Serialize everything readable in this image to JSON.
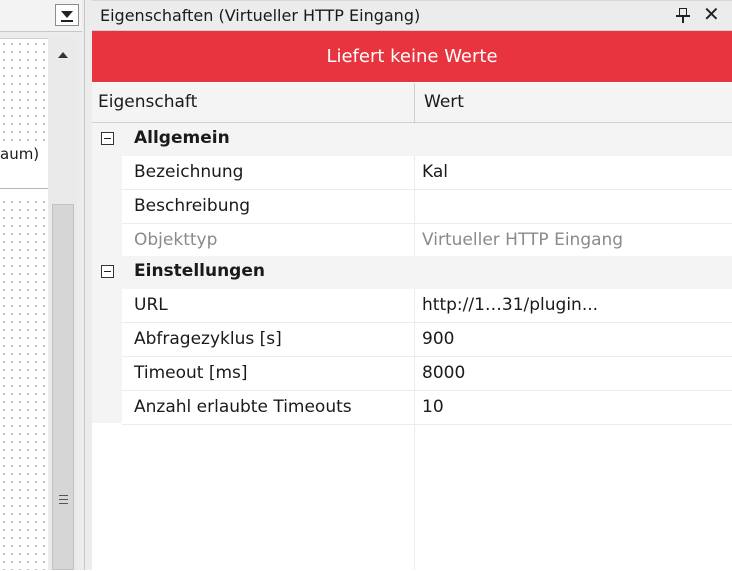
{
  "panel": {
    "title": "Eigenschaften (Virtueller HTTP Eingang)",
    "status_banner": "Liefert keine Werte",
    "banner_color": "#e8343f"
  },
  "left_pane": {
    "visible_label": "aum)"
  },
  "grid": {
    "columns": {
      "property": "Eigenschaft",
      "value": "Wert"
    },
    "categories": [
      {
        "label": "Allgemein",
        "properties": [
          {
            "name": "Bezeichnung",
            "value": "Kal"
          },
          {
            "name": "Beschreibung",
            "value": ""
          },
          {
            "name": "Objekttyp",
            "value": "Virtueller HTTP Eingang",
            "readonly": true
          }
        ]
      },
      {
        "label": "Einstellungen",
        "properties": [
          {
            "name": "URL",
            "value": "http://1…31/plugin..."
          },
          {
            "name": "Abfragezyklus [s]",
            "value": "900"
          },
          {
            "name": "Timeout [ms]",
            "value": "8000"
          },
          {
            "name": "Anzahl erlaubte Timeouts",
            "value": "10"
          }
        ]
      }
    ]
  },
  "icons": {
    "pin": "pin-icon",
    "close": "close-icon",
    "collapse": "collapse-toggle-icon",
    "dropdown": "chevron-down-icon",
    "scroll_up": "scroll-up-arrow-icon",
    "scroll_grip": "grip-icon"
  }
}
